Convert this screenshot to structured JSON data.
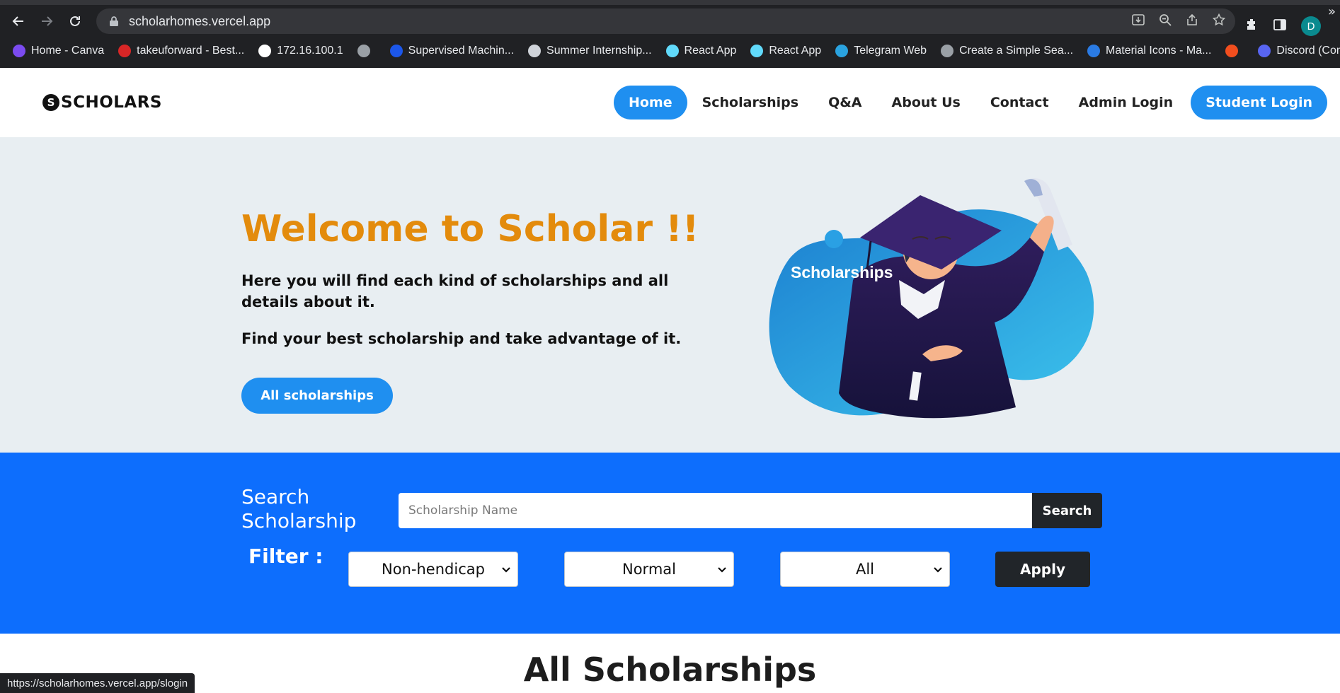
{
  "browser": {
    "url": "scholarhomes.vercel.app",
    "profile_initial": "D",
    "bookmarks": [
      {
        "label": "Home - Canva",
        "icon": "canva-icon",
        "color": "#7b4bf0"
      },
      {
        "label": "takeuforward - Best...",
        "icon": "tuf-icon",
        "color": "#d82626"
      },
      {
        "label": "172.16.100.1",
        "icon": "page-icon",
        "color": "#ffffff"
      },
      {
        "label": "",
        "icon": "globe-icon",
        "color": "#9aa0a6"
      },
      {
        "label": "Supervised Machin...",
        "icon": "coursera-icon",
        "color": "#1c57ea"
      },
      {
        "label": "Summer Internship...",
        "icon": "internship-icon",
        "color": "#cfd3d9"
      },
      {
        "label": "React App",
        "icon": "react-icon",
        "color": "#61dafb"
      },
      {
        "label": "React App",
        "icon": "react-icon",
        "color": "#61dafb"
      },
      {
        "label": "Telegram Web",
        "icon": "telegram-icon",
        "color": "#2aa3e0"
      },
      {
        "label": "Create a Simple Sea...",
        "icon": "globe-icon",
        "color": "#9aa0a6"
      },
      {
        "label": "Material Icons - Ma...",
        "icon": "material-icon",
        "color": "#2a7be4"
      },
      {
        "label": "",
        "icon": "figma-icon",
        "color": "#f24e1e"
      },
      {
        "label": "Discord (Comm...",
        "icon": "discord-icon",
        "color": "#5865f2"
      }
    ],
    "more_bookmarks": "»",
    "status_url": "https://scholarhomes.vercel.app/slogin"
  },
  "navbar": {
    "brand_mark": "S",
    "brand": "SCHOLARS",
    "links": [
      "Home",
      "Scholarships",
      "Q&A",
      "About Us",
      "Contact",
      "Admin Login",
      "Student Login"
    ]
  },
  "hero": {
    "title": "Welcome to Scholar !!",
    "paragraph1": "Here you will find each kind of scholarships and all details about it.",
    "paragraph2": "Find your best scholarship and take advantage of it.",
    "button": "All scholarships",
    "illustration_label": "Scholarships"
  },
  "search": {
    "label": "Search Scholarship",
    "placeholder": "Scholarship Name",
    "button": "Search",
    "filter_label": "Filter :",
    "filters": [
      "Non-hendicap",
      "Normal",
      "All"
    ],
    "apply": "Apply"
  },
  "section": {
    "title": "All Scholarships"
  },
  "colors": {
    "accent": "#1f8ff0",
    "band": "#0d6efd",
    "title_orange": "#e38b0c",
    "dark_button": "#212529"
  }
}
